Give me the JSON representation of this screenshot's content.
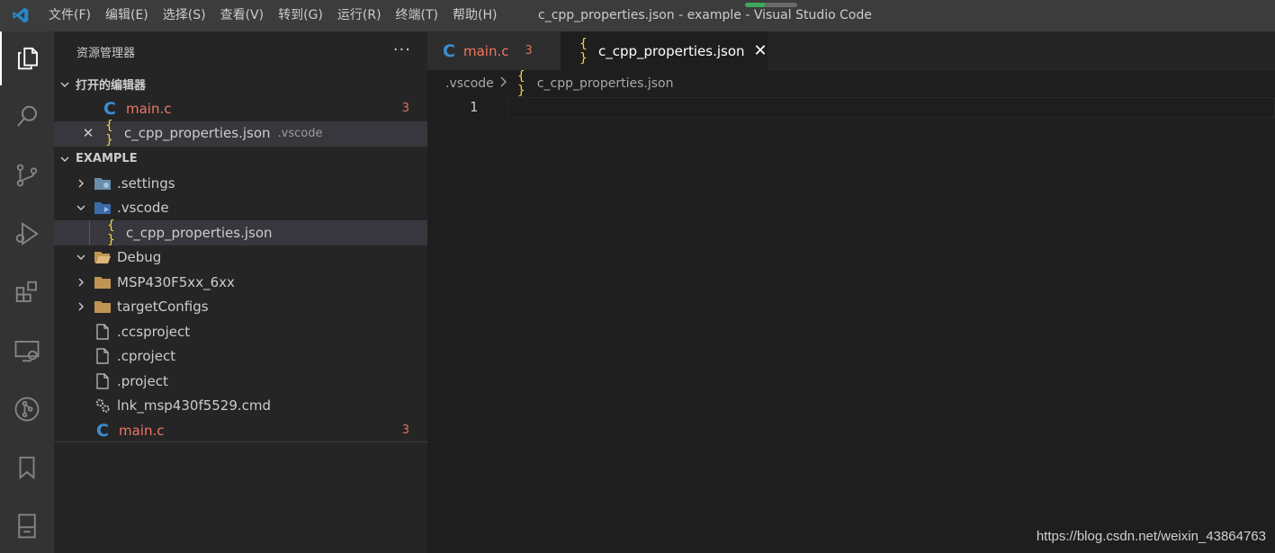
{
  "titlebar": {
    "menu": [
      "文件(F)",
      "编辑(E)",
      "选择(S)",
      "查看(V)",
      "转到(G)",
      "运行(R)",
      "终端(T)",
      "帮助(H)"
    ],
    "window_title": "c_cpp_properties.json - example - Visual Studio Code"
  },
  "activitybar": {
    "icons": [
      "explorer-icon",
      "search-icon",
      "source-control-icon",
      "run-debug-icon",
      "extensions-icon",
      "remote-explorer-icon",
      "git-graph-icon",
      "bookmarks-icon",
      "panel-icon"
    ]
  },
  "sidebar": {
    "title": "资源管理器",
    "more": "···",
    "open_editors": {
      "title": "打开的编辑器",
      "items": [
        {
          "label": "main.c",
          "badge": "3"
        },
        {
          "label": "c_cpp_properties.json",
          "desc": ".vscode"
        }
      ]
    },
    "workspace": {
      "title": "EXAMPLE",
      "items": [
        {
          "label": ".settings"
        },
        {
          "label": ".vscode"
        },
        {
          "label": "c_cpp_properties.json"
        },
        {
          "label": "Debug"
        },
        {
          "label": "MSP430F5xx_6xx"
        },
        {
          "label": "targetConfigs"
        },
        {
          "label": ".ccsproject"
        },
        {
          "label": ".cproject"
        },
        {
          "label": ".project"
        },
        {
          "label": "lnk_msp430f5529.cmd"
        },
        {
          "label": "main.c",
          "badge": "3"
        }
      ]
    }
  },
  "editor": {
    "tabs": [
      {
        "label": "main.c",
        "badge": "3"
      },
      {
        "label": "c_cpp_properties.json",
        "close": "✕"
      }
    ],
    "breadcrumb": [
      ".vscode",
      "c_cpp_properties.json"
    ],
    "line_number": "1"
  },
  "watermark": "https://blog.csdn.net/weixin_43864763",
  "colors": {
    "accent_blue": "#3b8ed0",
    "json_yellow": "#f5d63f",
    "error_red": "#f07762"
  }
}
